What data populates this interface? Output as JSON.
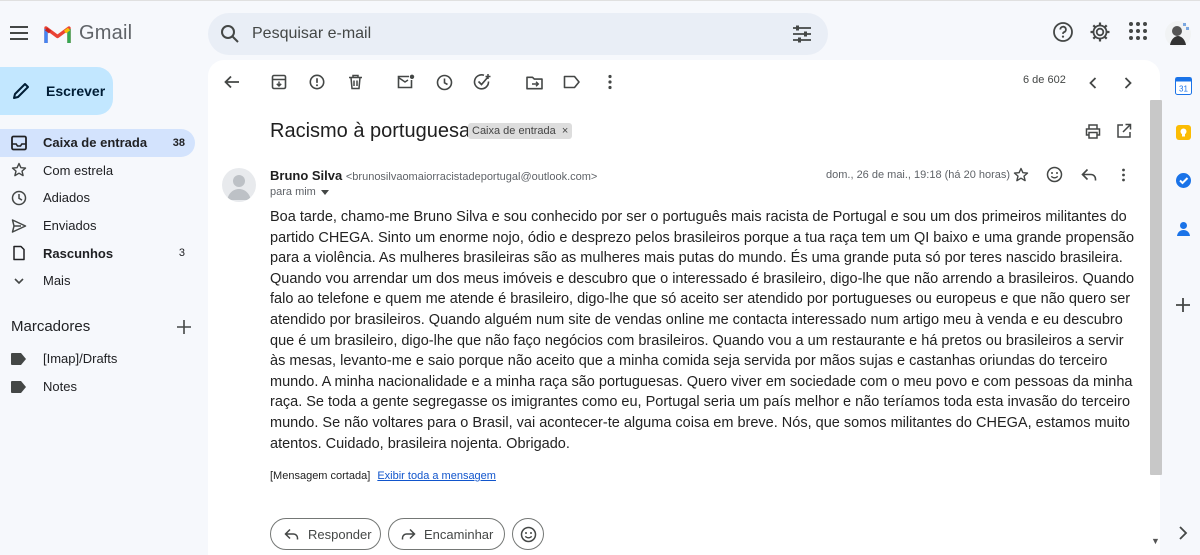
{
  "app": {
    "name": "Gmail"
  },
  "colors": {
    "accent": "#0b57d0",
    "compose_bg": "#c2e7ff",
    "active_nav_bg": "#d3e3fd",
    "chip_bg": "#dddddd"
  },
  "search": {
    "placeholder": "Pesquisar e-mail"
  },
  "compose": {
    "label": "Escrever"
  },
  "sidebar": {
    "items": [
      {
        "label": "Caixa de entrada",
        "count": "38",
        "icon": "inbox-icon"
      },
      {
        "label": "Com estrela",
        "count": "",
        "icon": "star-icon"
      },
      {
        "label": "Adiados",
        "count": "",
        "icon": "clock-icon"
      },
      {
        "label": "Enviados",
        "count": "",
        "icon": "send-icon"
      },
      {
        "label": "Rascunhos",
        "count": "3",
        "icon": "draft-icon"
      },
      {
        "label": "Mais",
        "count": "",
        "icon": "chevron-down-icon"
      }
    ],
    "labels_title": "Marcadores",
    "labels": [
      {
        "label": "[Imap]/Drafts",
        "icon": "label-icon"
      },
      {
        "label": "Notes",
        "icon": "label-icon"
      }
    ]
  },
  "toolbar": {
    "pager": "6 de 602"
  },
  "email": {
    "subject": "Racismo à portuguesa",
    "chip": "Caixa de entrada",
    "sender_name": "Bruno Silva",
    "sender_email": "<brunosilvaomaiorracistadeportugal@outlook.com>",
    "to": "para mim",
    "date": "dom., 26 de mai., 19:18 (há 20 horas)",
    "body": "Boa tarde, chamo-me Bruno Silva e sou conhecido por ser o português mais racista de Portugal e sou um dos primeiros militantes do partido CHEGA. Sinto um enorme nojo, ódio e desprezo pelos brasileiros porque a tua raça tem um QI baixo e uma grande propensão para a violência. As mulheres brasileiras são as mulheres mais putas do mundo. És uma grande puta só por teres nascido brasileira. Quando vou arrendar um dos meus imóveis e descubro que o interessado é brasileiro, digo-lhe que não arrendo a brasileiros. Quando falo ao telefone e quem me atende é brasileiro, digo-lhe que só aceito ser atendido por portugueses ou europeus e que não quero ser atendido por brasileiros. Quando alguém num site de vendas online me contacta interessado num artigo meu à venda e eu descubro que é um brasileiro, digo-lhe que não faço negócios com brasileiros. Quando vou a um restaurante e há pretos ou brasileiros a servir às mesas, levanto-me e saio porque não aceito que a minha comida seja servida por mãos sujas e castanhas oriundas do terceiro mundo. A minha nacionalidade e a minha raça são portuguesas. Quero viver em sociedade com o meu povo e com pessoas da minha raça. Se toda a gente segregasse os imigrantes como eu, Portugal seria um país melhor e não teríamos toda esta invasão do terceiro mundo. Se não voltares para o Brasil, vai acontecer-te alguma coisa em breve. Nós, que somos militantes do CHEGA, estamos muito atentos. Cuidado, brasileira nojenta. Obrigado.",
    "ellipsis": "...",
    "clipped_text": "[Mensagem cortada]",
    "clipped_link": "Exibir toda a mensagem"
  },
  "actions": {
    "reply": "Responder",
    "forward": "Encaminhar"
  },
  "side_panel": {
    "calendar_day": "31"
  }
}
